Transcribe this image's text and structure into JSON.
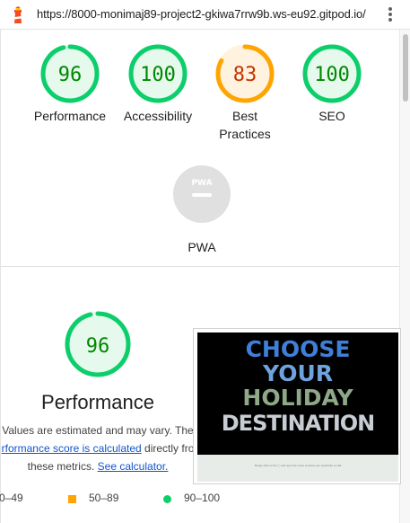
{
  "browser": {
    "url": "https://8000-monimaj89-project2-gkiwa7rrw9b.ws-eu92.gitpod.io/",
    "logo_icon": "lighthouse-icon",
    "menu_icon": "more-vert-icon"
  },
  "colors": {
    "pass": "#0cce6b",
    "pass_text": "#008800",
    "average": "#ffa400",
    "average_text": "#c33300",
    "na": "#e0e0e0"
  },
  "scores": [
    {
      "id": "performance",
      "score": 96,
      "label": "Performance",
      "rating": "pass"
    },
    {
      "id": "accessibility",
      "score": 100,
      "label": "Accessibility",
      "rating": "pass"
    },
    {
      "id": "best-practices",
      "score": 83,
      "label": "Best Practices",
      "rating": "average"
    },
    {
      "id": "seo",
      "score": 100,
      "label": "SEO",
      "rating": "pass"
    }
  ],
  "pwa": {
    "label": "PWA",
    "badge_text": "PWA",
    "icon": "pwa-badge-icon"
  },
  "performance": {
    "score": 96,
    "title": "Performance",
    "desc_line1": "Values are estimated and may vary. The",
    "desc_link1": "rformance score is calculated",
    "desc_line2_rest": "directly fro",
    "desc_line3": "these metrics.",
    "desc_link2": "See calculator."
  },
  "legend": {
    "fail_range": "0–49",
    "average_range": "50–89",
    "pass_range": "90–100"
  },
  "screenshot": {
    "lines": [
      "CHOOSE",
      "YOUR",
      "HOLIDAY",
      "DESTINATION"
    ],
    "footer_text": "Simply click on the ⓘ and open the name of where you would like to visit"
  }
}
